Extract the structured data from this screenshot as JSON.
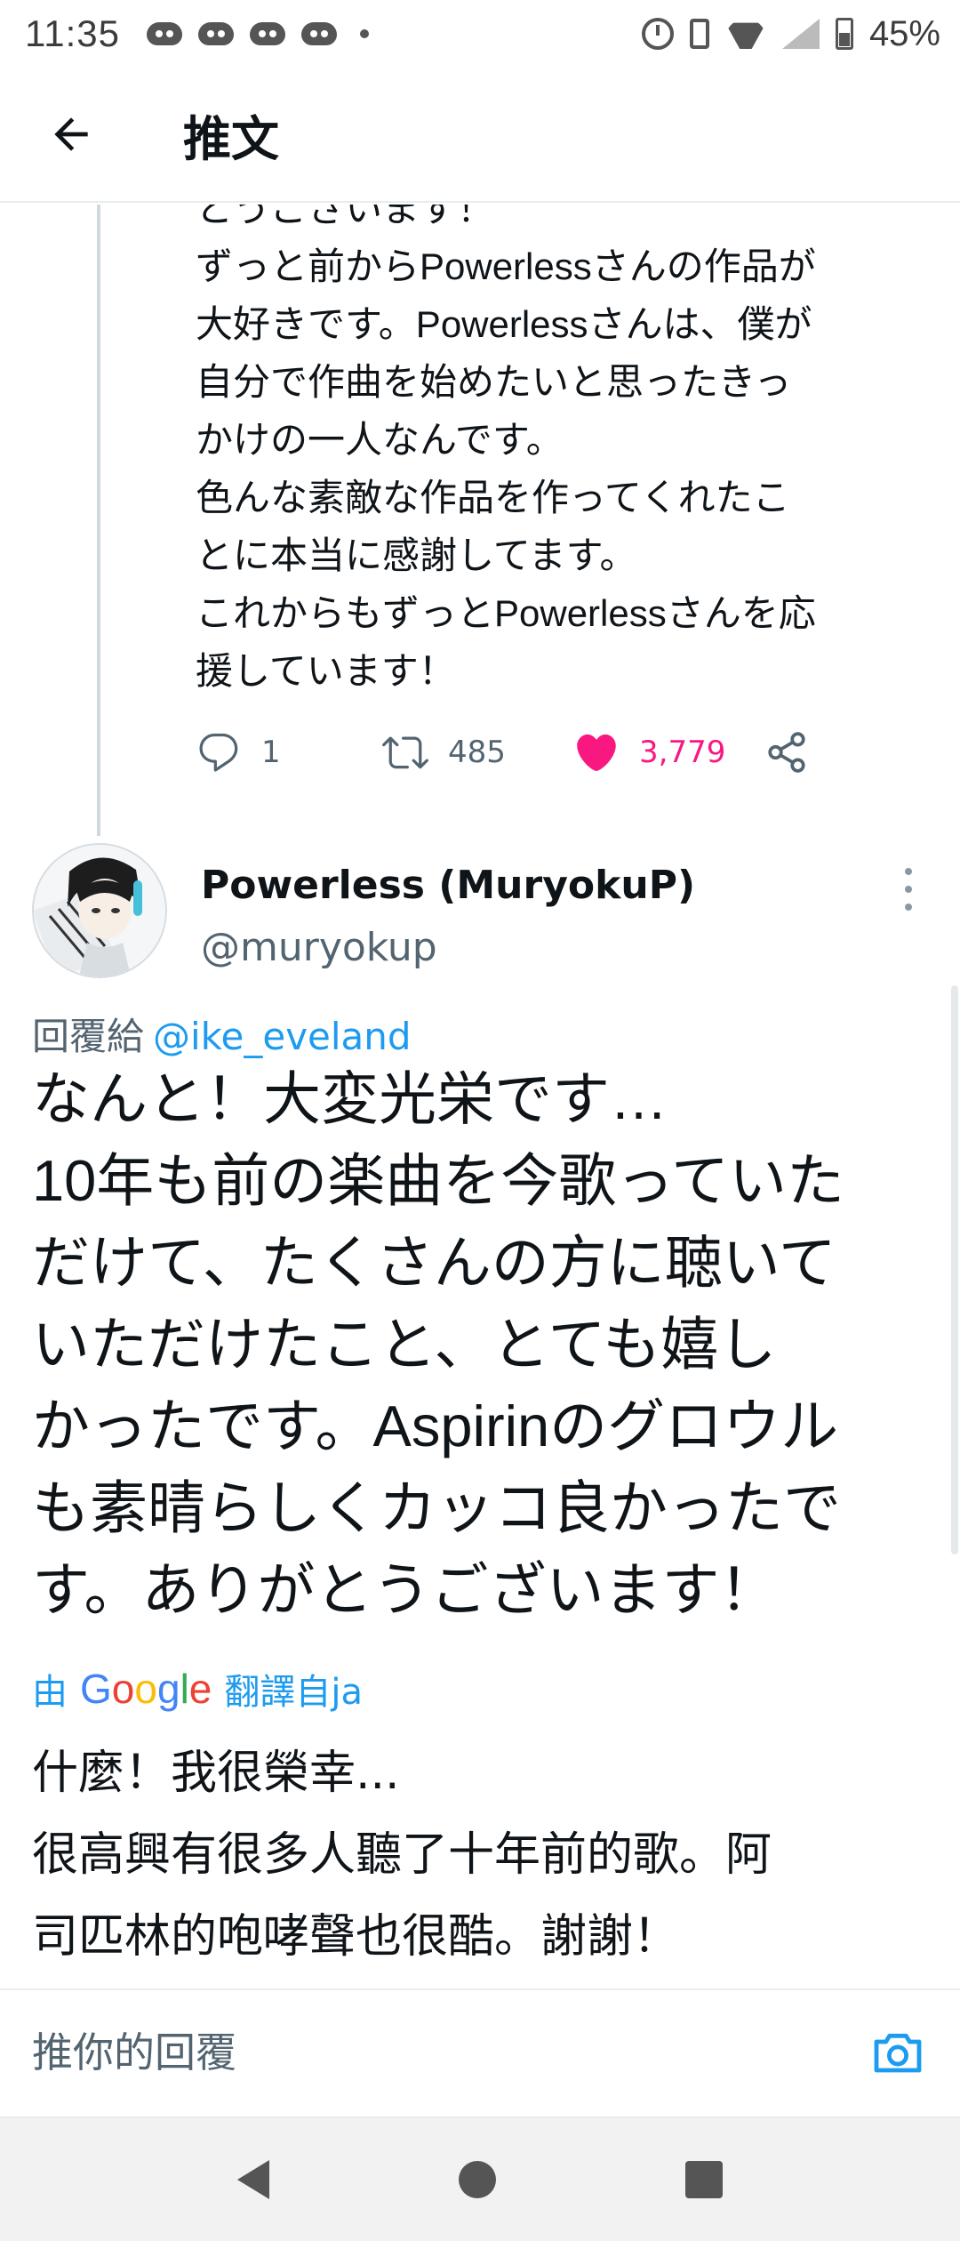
{
  "status_bar": {
    "time": "11:35",
    "battery": "45%",
    "icons": [
      "discord-icon",
      "discord-icon",
      "discord-icon",
      "discord-icon",
      "dot",
      "alarm-icon",
      "vibrate-icon",
      "wifi-icon",
      "signal-icon",
      "battery-icon"
    ]
  },
  "header": {
    "title": "推文",
    "back_icon": "arrow-left-icon"
  },
  "previous_tweet": {
    "text": "とうございます！\nずっと前からPowerlessさんの作品が\n大好きです。Powerlessさんは、僕が\n自分で作曲を始めたいと思ったきっ\nかけの一人なんです。\n色んな素敵な作品を作ってくれたこ\nとに本当に感謝してます。\nこれからもずっとPowerlessさんを応\n援しています！",
    "replies": "1",
    "retweets": "485",
    "likes": "3,779",
    "like_color": "#f91880"
  },
  "main_tweet": {
    "author_name": "Powerless (MuryokuP)",
    "author_handle": "@muryokup",
    "reply_to_label": "回覆給",
    "reply_to_handle": "@ike_eveland",
    "text": "なんと！大変光栄です…\n10年も前の楽曲を今歌っていた\nだけて、たくさんの方に聴いて\nいただけたこと、とても嬉し\nかったです。Aspirinのグロウル\nも素晴らしくカッコ良かったで\nす。ありがとうございます！",
    "translated_prefix": "由",
    "translated_suffix": "翻譯自ja",
    "translated_text": "什麼！我很榮幸...\n很高興有很多人聽了十年前的歌。阿\n司匹林的咆哮聲也很酷。謝謝！",
    "link_color": "#1d9bf0"
  },
  "reply_bar": {
    "placeholder": "推你的回覆"
  }
}
